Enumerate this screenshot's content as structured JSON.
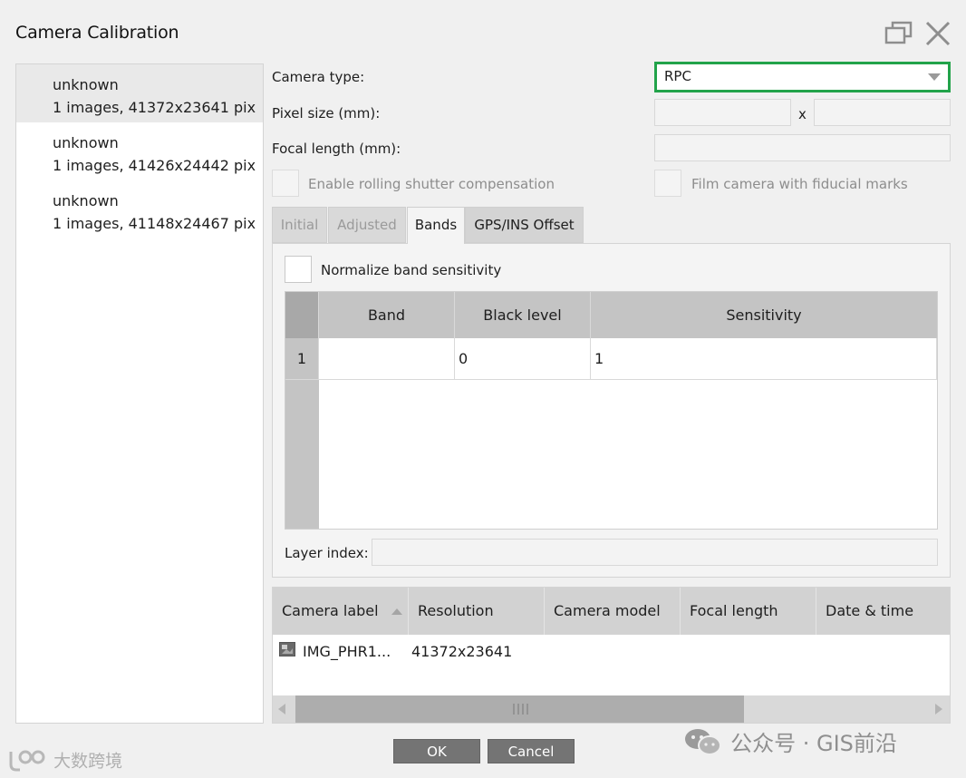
{
  "window": {
    "title": "Camera Calibration"
  },
  "camera_groups": [
    {
      "name": "unknown",
      "summary": "1 images, 41372x23641 pix",
      "selected": true
    },
    {
      "name": "unknown",
      "summary": "1 images, 41426x24442 pix",
      "selected": false
    },
    {
      "name": "unknown",
      "summary": "1 images, 41148x24467 pix",
      "selected": false
    }
  ],
  "form": {
    "camera_type_label": "Camera type:",
    "camera_type_value": "RPC",
    "pixel_size_label": "Pixel size (mm):",
    "pixel_size_x": "",
    "pixel_size_sep": "x",
    "pixel_size_y": "",
    "focal_length_label": "Focal length (mm):",
    "focal_length_value": "",
    "rolling_shutter_label": "Enable rolling shutter compensation",
    "film_camera_label": "Film camera with fiducial marks"
  },
  "tabs": [
    {
      "label": "Initial",
      "state": "disabled"
    },
    {
      "label": "Adjusted",
      "state": "disabled"
    },
    {
      "label": "Bands",
      "state": "active"
    },
    {
      "label": "GPS/INS Offset",
      "state": "normal"
    }
  ],
  "bands": {
    "normalize_label": "Normalize band sensitivity",
    "columns": [
      "Band",
      "Black level",
      "Sensitivity"
    ],
    "rows": [
      {
        "index": "1",
        "band": "",
        "black_level": "0",
        "sensitivity": "1"
      }
    ],
    "layer_index_label": "Layer index:",
    "layer_index_value": ""
  },
  "camera_table": {
    "columns": [
      "Camera label",
      "Resolution",
      "Camera model",
      "Focal length",
      "Date & time"
    ],
    "sort_column": "Camera label",
    "rows": [
      {
        "label": "IMG_PHR1...",
        "resolution": "41372x23641",
        "model": "",
        "focal_length": "",
        "datetime": ""
      }
    ],
    "scroll_position": 0.0
  },
  "buttons": {
    "ok": "OK",
    "cancel": "Cancel"
  },
  "watermarks": {
    "left": "大数跨境",
    "right": "公众号 · GIS前沿"
  },
  "colors": {
    "highlight_border": "#22a34a",
    "button_bg": "#747474"
  }
}
